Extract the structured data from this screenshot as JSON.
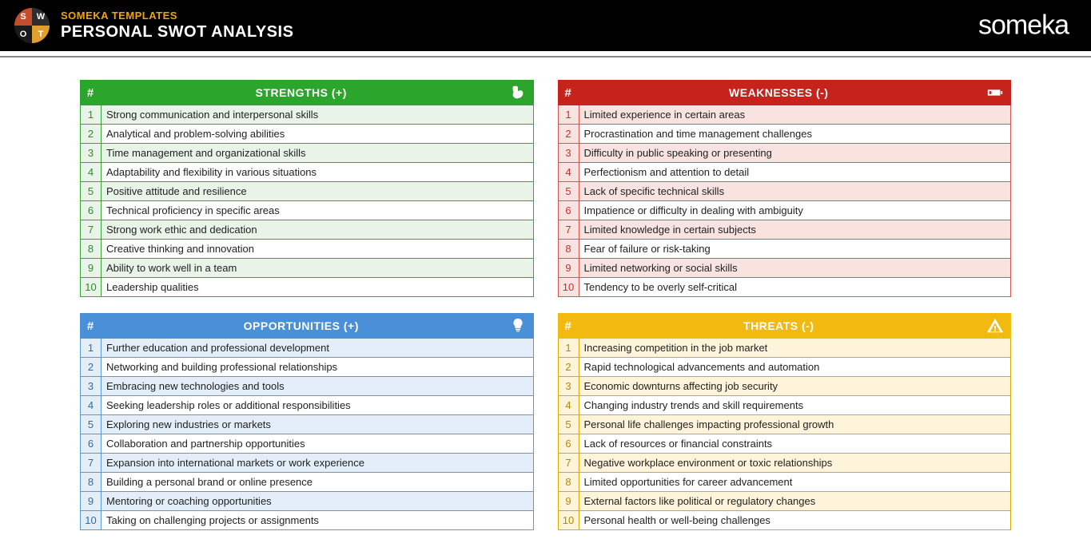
{
  "header": {
    "subtitle": "SOMEKA TEMPLATES",
    "title": "PERSONAL SWOT ANALYSIS",
    "brand": "someka",
    "logo_letters": {
      "s": "S",
      "w": "W",
      "o": "O",
      "t": "T"
    }
  },
  "panels": {
    "strengths": {
      "title": "STRENGTHS (+)",
      "hash": "#",
      "items": [
        "Strong communication and interpersonal skills",
        "Analytical and problem-solving abilities",
        "Time management and organizational skills",
        "Adaptability and flexibility in various situations",
        "Positive attitude and resilience",
        "Technical proficiency in specific areas",
        "Strong work ethic and dedication",
        "Creative thinking and innovation",
        "Ability to work well in a team",
        "Leadership qualities"
      ]
    },
    "weaknesses": {
      "title": "WEAKNESSES (-)",
      "hash": "#",
      "items": [
        "Limited experience in certain areas",
        "Procrastination and time management challenges",
        "Difficulty in public speaking or presenting",
        "Perfectionism and attention to detail",
        "Lack of specific technical skills",
        "Impatience or difficulty in dealing with ambiguity",
        "Limited knowledge in certain subjects",
        "Fear of failure or risk-taking",
        "Limited networking or social skills",
        "Tendency to be overly self-critical"
      ]
    },
    "opportunities": {
      "title": "OPPORTUNITIES (+)",
      "hash": "#",
      "items": [
        "Further education and professional development",
        "Networking and building professional relationships",
        "Embracing new technologies and tools",
        "Seeking leadership roles or additional responsibilities",
        "Exploring new industries or markets",
        "Collaboration and partnership opportunities",
        "Expansion into international markets or work experience",
        "Building a personal brand or online presence",
        "Mentoring or coaching opportunities",
        "Taking on challenging projects or assignments"
      ]
    },
    "threats": {
      "title": "THREATS (-)",
      "hash": "#",
      "items": [
        "Increasing competition in the job market",
        "Rapid technological advancements and automation",
        "Economic downturns affecting job security",
        "Changing industry trends and skill requirements",
        "Personal life challenges impacting professional growth",
        "Lack of resources or financial constraints",
        "Negative workplace environment or toxic relationships",
        "Limited opportunities for career advancement",
        "External factors like political or regulatory changes",
        "Personal health or well-being challenges"
      ]
    }
  }
}
